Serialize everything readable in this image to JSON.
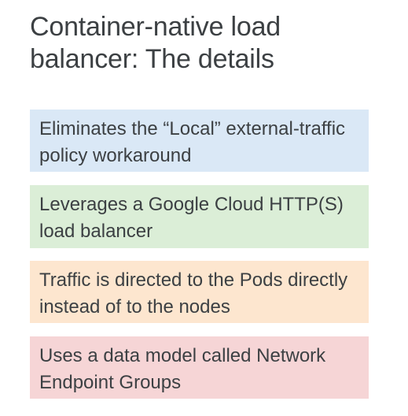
{
  "title": "Container-native load balancer: The details",
  "cards": [
    {
      "text": "Eliminates the “Local” external-traffic policy workaround",
      "color": "#dae8f6"
    },
    {
      "text": "Leverages a Google Cloud HTTP(S) load balancer",
      "color": "#dbeed7"
    },
    {
      "text": "Traffic is directed to the Pods directly instead of to the nodes",
      "color": "#fde6cf"
    },
    {
      "text": "Uses a data model called Network Endpoint Groups",
      "color": "#f6d5d6"
    }
  ]
}
